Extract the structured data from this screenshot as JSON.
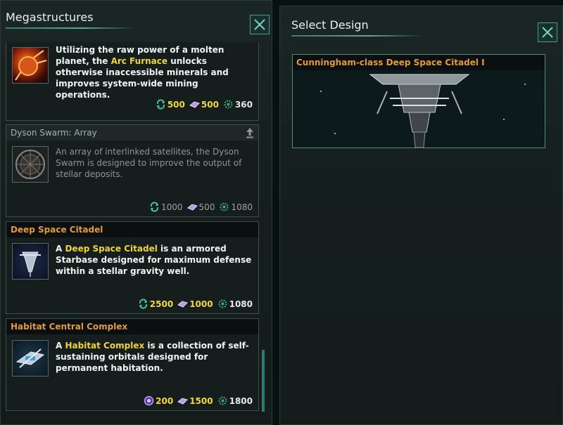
{
  "left_panel": {
    "title": "Megastructures",
    "close_icon": "close-icon"
  },
  "right_panel": {
    "title": "Select Design",
    "close_icon": "close-icon",
    "designs": [
      {
        "name": "Cunningham-class Deep Space Citadel I"
      }
    ]
  },
  "cards": [
    {
      "name": "",
      "icon": "arc-furnace-icon",
      "desc_pre": "Utilizing the raw power of a molten planet, the ",
      "desc_hl": "Arc Furnace",
      "desc_post": " unlocks otherwise inaccessible minerals and improves system-wide mining operations.",
      "costs": [
        {
          "icon": "influence-cycle-icon",
          "value": "500"
        },
        {
          "icon": "alloy-icon",
          "value": "500"
        },
        {
          "icon": "time-icon",
          "value": "360"
        }
      ]
    },
    {
      "name": "Dyson Swarm: Array",
      "icon": "dyson-swarm-icon",
      "upgrade_icon": "upgrade-arrow-icon",
      "desc": "An array of interlinked satellites, the Dyson Swarm is designed to improve the output of stellar deposits.",
      "costs": [
        {
          "icon": "influence-cycle-icon",
          "value": "1000"
        },
        {
          "icon": "alloy-icon",
          "value": "500"
        },
        {
          "icon": "time-icon",
          "value": "1080"
        }
      ]
    },
    {
      "name": "Deep Space Citadel",
      "icon": "citadel-icon",
      "desc_pre": "A ",
      "desc_hl": "Deep Space Citadel",
      "desc_post": " is an armored Starbase designed for maximum defense within a stellar gravity well.",
      "costs": [
        {
          "icon": "influence-cycle-icon",
          "value": "2500"
        },
        {
          "icon": "alloy-icon",
          "value": "1000"
        },
        {
          "icon": "time-icon",
          "value": "1080"
        }
      ]
    },
    {
      "name": "Habitat Central Complex",
      "icon": "habitat-icon",
      "desc_pre": "A ",
      "desc_hl": "Habitat Complex",
      "desc_post": " is a collection of self-sustaining orbitals designed for permanent habitation.",
      "costs": [
        {
          "icon": "unity-icon",
          "value": "200"
        },
        {
          "icon": "alloy-icon",
          "value": "1500"
        },
        {
          "icon": "time-icon",
          "value": "1800"
        }
      ]
    }
  ],
  "colors": {
    "accent": "#4f9a8a",
    "header_orange": "#e19b3c",
    "highlight_yellow": "#f0d43a"
  }
}
